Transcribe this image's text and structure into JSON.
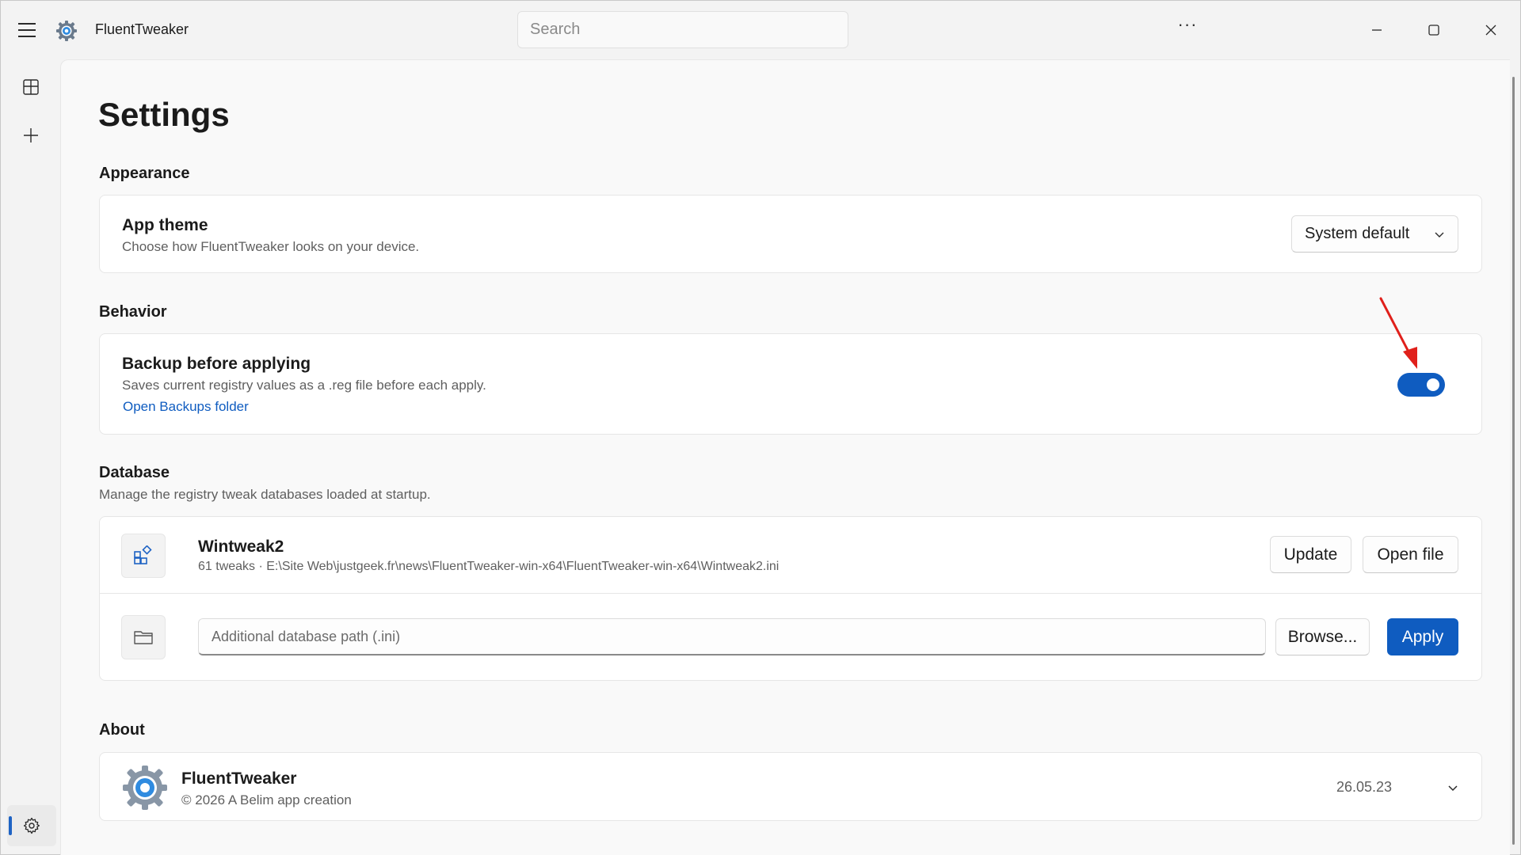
{
  "window": {
    "app_title": "FluentTweaker"
  },
  "titlebar": {
    "search_placeholder": "Search",
    "more_label": "···"
  },
  "nav": {
    "items": [
      {
        "icon": "tweaks-icon"
      },
      {
        "icon": "add-icon"
      },
      {
        "icon": "gear-icon",
        "selected": true
      }
    ]
  },
  "page": {
    "title": "Settings"
  },
  "appearance": {
    "label": "Appearance",
    "app_theme": {
      "title": "App theme",
      "description": "Choose how FluentTweaker looks on your device.",
      "selected": "System default"
    }
  },
  "behavior": {
    "label": "Behavior",
    "backup": {
      "title": "Backup before applying",
      "description": "Saves current registry values as a .reg file before each apply.",
      "link": "Open Backups folder",
      "enabled": true
    }
  },
  "database": {
    "label": "Database",
    "description": "Manage the registry tweak databases loaded at startup.",
    "entry": {
      "name": "Wintweak2",
      "details": "61 tweaks · E:\\Site Web\\justgeek.fr\\news\\FluentTweaker-win-x64\\FluentTweaker-win-x64\\Wintweak2.ini",
      "update_label": "Update",
      "open_label": "Open file"
    },
    "additional": {
      "placeholder": "Additional database path (.ini)",
      "value": "",
      "browse_label": "Browse...",
      "apply_label": "Apply"
    }
  },
  "about": {
    "label": "About",
    "app_name": "FluentTweaker",
    "copyright": "© 2026 A Belim app creation",
    "version": "26.05.23"
  },
  "colors": {
    "accent": "#0f5cc0",
    "annotation_arrow": "#e0201b"
  }
}
